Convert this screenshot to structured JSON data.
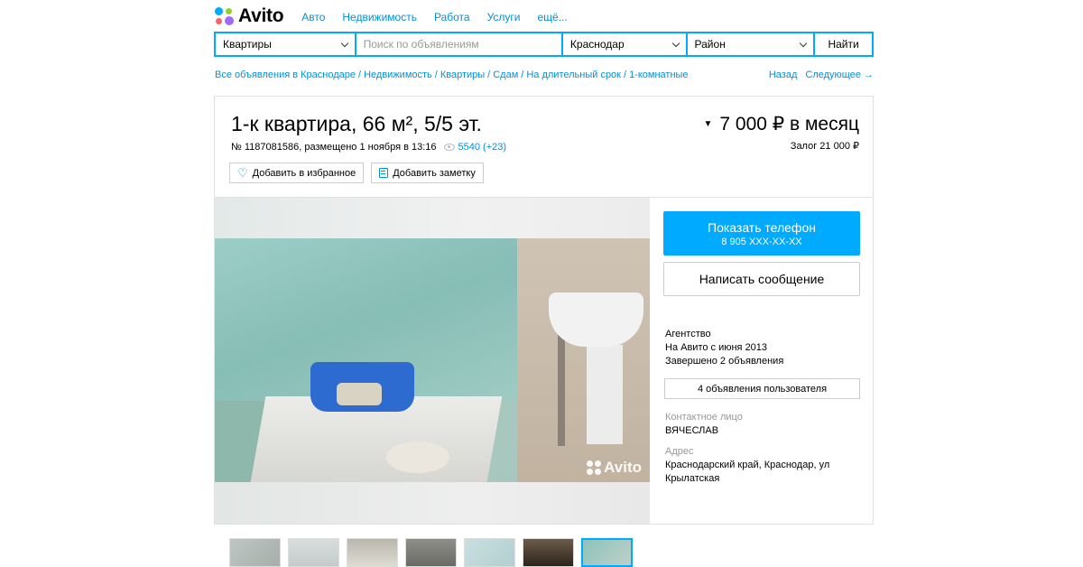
{
  "header": {
    "logo_text": "Avito",
    "nav": [
      "Авто",
      "Недвижимость",
      "Работа",
      "Услуги",
      "ещё..."
    ]
  },
  "search": {
    "category": "Квартиры",
    "query_placeholder": "Поиск по объявлениям",
    "city": "Краснодар",
    "district": "Район",
    "submit_label": "Найти"
  },
  "breadcrumbs": [
    "Все объявления в Краснодаре",
    "Недвижимость",
    "Квартиры",
    "Сдам",
    "На длительный срок",
    "1-комнатные"
  ],
  "pager": {
    "back": "Назад",
    "next": "Следующее →"
  },
  "listing": {
    "title": "1-к квартира, 66 м², 5/5 эт.",
    "meta": "№ 1187081586, размещено 1 ноября в 13:16",
    "views": "5540 (+23)",
    "price": "7 000 ₽ в месяц",
    "deposit": "Залог 21 000 ₽",
    "favorite_label": "Добавить в избранное",
    "note_label": "Добавить заметку",
    "photo_watermark": "Avito",
    "thumbnail_count": 7
  },
  "sidebar": {
    "phone_button": "Показать телефон",
    "phone_masked": "8 905 XXX-XX-XX",
    "message_button": "Написать сообщение",
    "seller_type": "Агентство",
    "seller_since": "На Авито с июня 2013",
    "seller_completed": "Завершено 2 объявления",
    "user_ads_button": "4 объявления пользователя",
    "contact_label": "Контактное лицо",
    "contact_name": "ВЯЧЕСЛАВ",
    "address_label": "Адрес",
    "address_value": "Краснодарский край, Краснодар, ул Крылатская"
  },
  "colors": {
    "accent": "#00aaff",
    "link": "#0091d9"
  }
}
